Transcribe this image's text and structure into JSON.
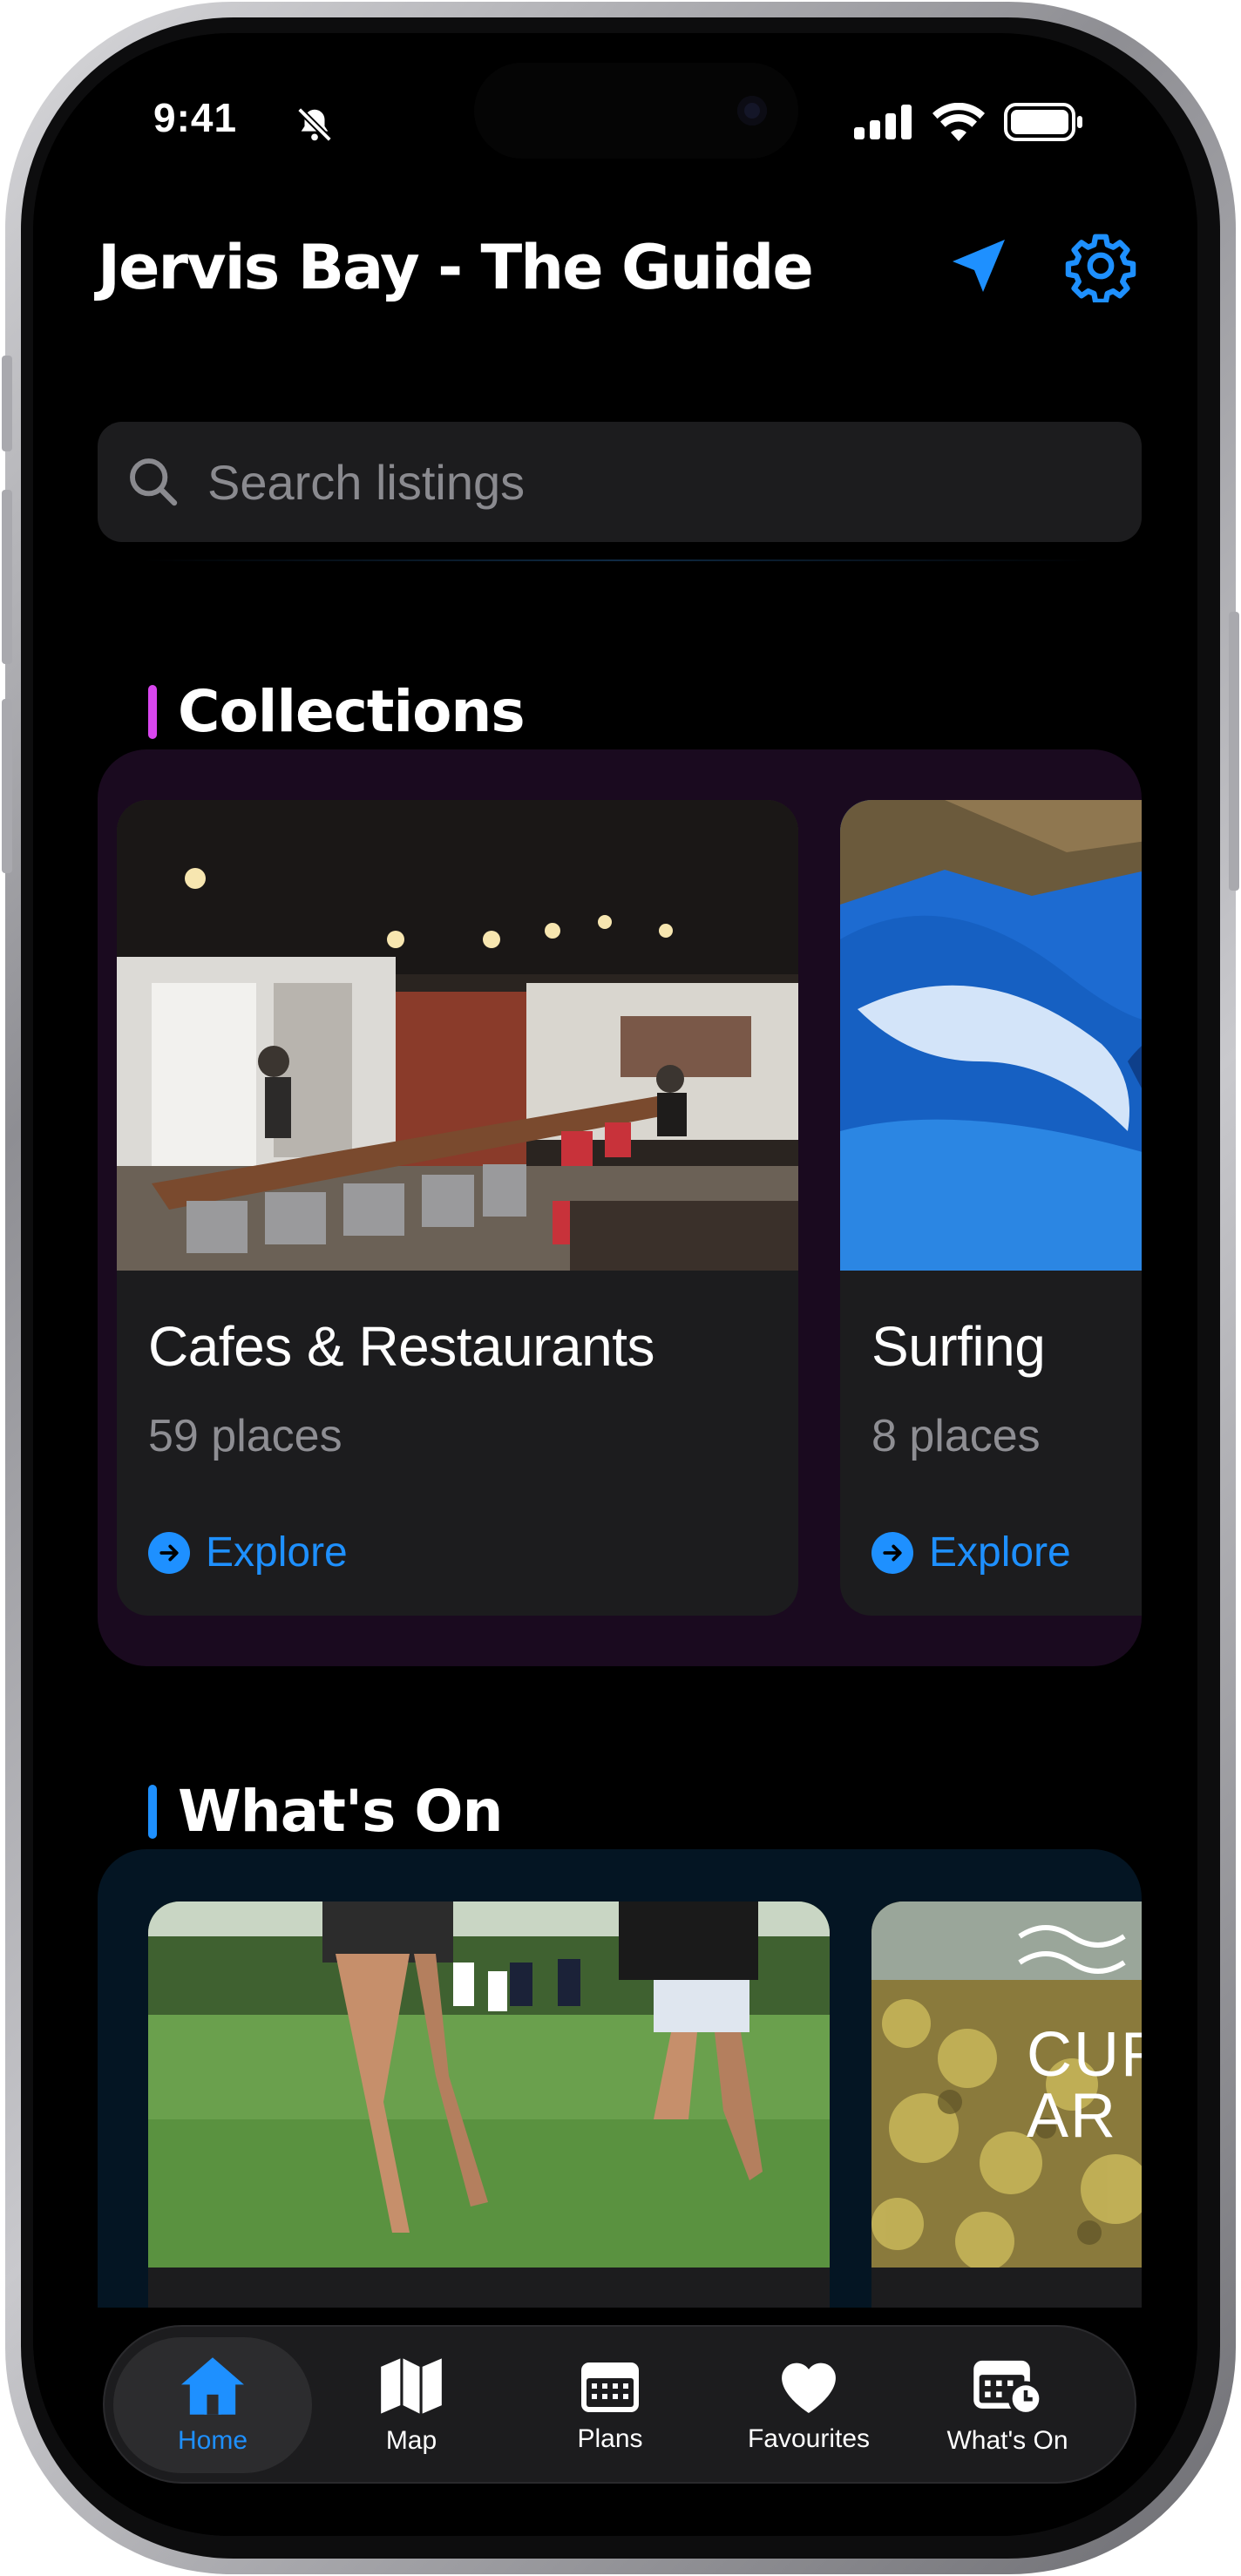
{
  "status_bar": {
    "time": "9:41"
  },
  "header": {
    "title": "Jervis Bay - The Guide"
  },
  "search": {
    "placeholder": "Search listings"
  },
  "collections": {
    "heading": "Collections",
    "accent": "#d946ef",
    "panel_bg": "#1a0a1f",
    "cards": [
      {
        "title": "Cafes & Restaurants",
        "subtitle": "59 places",
        "action": "Explore",
        "image": "cafe-interior-photo"
      },
      {
        "title": "Surfing",
        "subtitle": "8 places",
        "action": "Explore",
        "image": "wave-surfer-photo"
      }
    ]
  },
  "whats_on": {
    "heading": "What's On",
    "accent": "#1e90ff",
    "panel_bg": "#041523",
    "cards": [
      {
        "image": "parkrun-runners-photo"
      },
      {
        "image": "curated-art-poster",
        "image_text": [
          "CUR",
          "AR"
        ]
      }
    ]
  },
  "tab_bar": {
    "items": [
      {
        "label": "Home",
        "icon": "house-icon",
        "active": true
      },
      {
        "label": "Map",
        "icon": "map-icon",
        "active": false
      },
      {
        "label": "Plans",
        "icon": "calendar-icon",
        "active": false
      },
      {
        "label": "Favourites",
        "icon": "heart-icon",
        "active": false
      },
      {
        "label": "What's On",
        "icon": "calendar-clock-icon",
        "active": false
      }
    ]
  },
  "colors": {
    "accent_blue": "#1e90ff",
    "background": "#000000",
    "surface": "#1c1c1e"
  }
}
